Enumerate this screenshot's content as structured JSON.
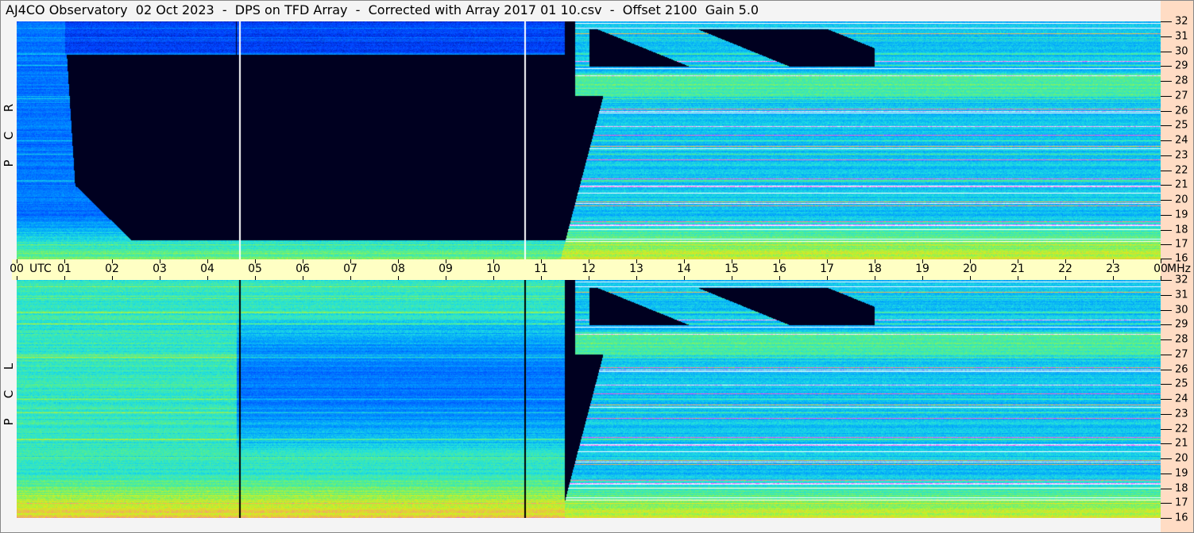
{
  "title": "AJ4CO Observatory  02 Oct 2023  -  DPS on TFD Array  -  Corrected with Array 2017 01 10.csv  -  Offset 2100  Gain 5.0",
  "panels": {
    "top": {
      "letters": [
        "R",
        "C",
        "P"
      ]
    },
    "bottom": {
      "letters": [
        "L",
        "C",
        "P"
      ]
    }
  },
  "time_axis": {
    "unit": "UTC",
    "labels": [
      "00",
      "01",
      "02",
      "03",
      "04",
      "05",
      "06",
      "07",
      "08",
      "09",
      "10",
      "11",
      "12",
      "13",
      "14",
      "15",
      "16",
      "17",
      "18",
      "19",
      "20",
      "21",
      "22",
      "23",
      "00"
    ]
  },
  "freq_axis": {
    "unit": "MHz",
    "labels": [
      "16",
      "17",
      "18",
      "19",
      "20",
      "21",
      "22",
      "23",
      "24",
      "25",
      "26",
      "27",
      "28",
      "29",
      "30",
      "31",
      "32"
    ]
  },
  "chart_data": {
    "type": "heatmap",
    "title": "AJ4CO Observatory 02 Oct 2023 - DPS on TFD Array",
    "xlabel": "UTC",
    "ylabel": "MHz",
    "xlim": [
      0,
      24
    ],
    "ylim": [
      16,
      32
    ],
    "series": [
      {
        "name": "RCP",
        "description_of_structure": "low intensity 01-12 UTC above 17 MHz; strong RFI bands near 27-28 MHz after 12 UTC"
      },
      {
        "name": "LCP",
        "description_of_structure": "moderate intensity throughout; low intensity 12-18 UTC above 29 MHz"
      }
    ],
    "colormap": [
      "#000000",
      "#000060",
      "#0040ff",
      "#00a0ff",
      "#20e0e0",
      "#60f080",
      "#d0f020",
      "#f0c040",
      "#ff40ff",
      "#ffffff"
    ]
  }
}
